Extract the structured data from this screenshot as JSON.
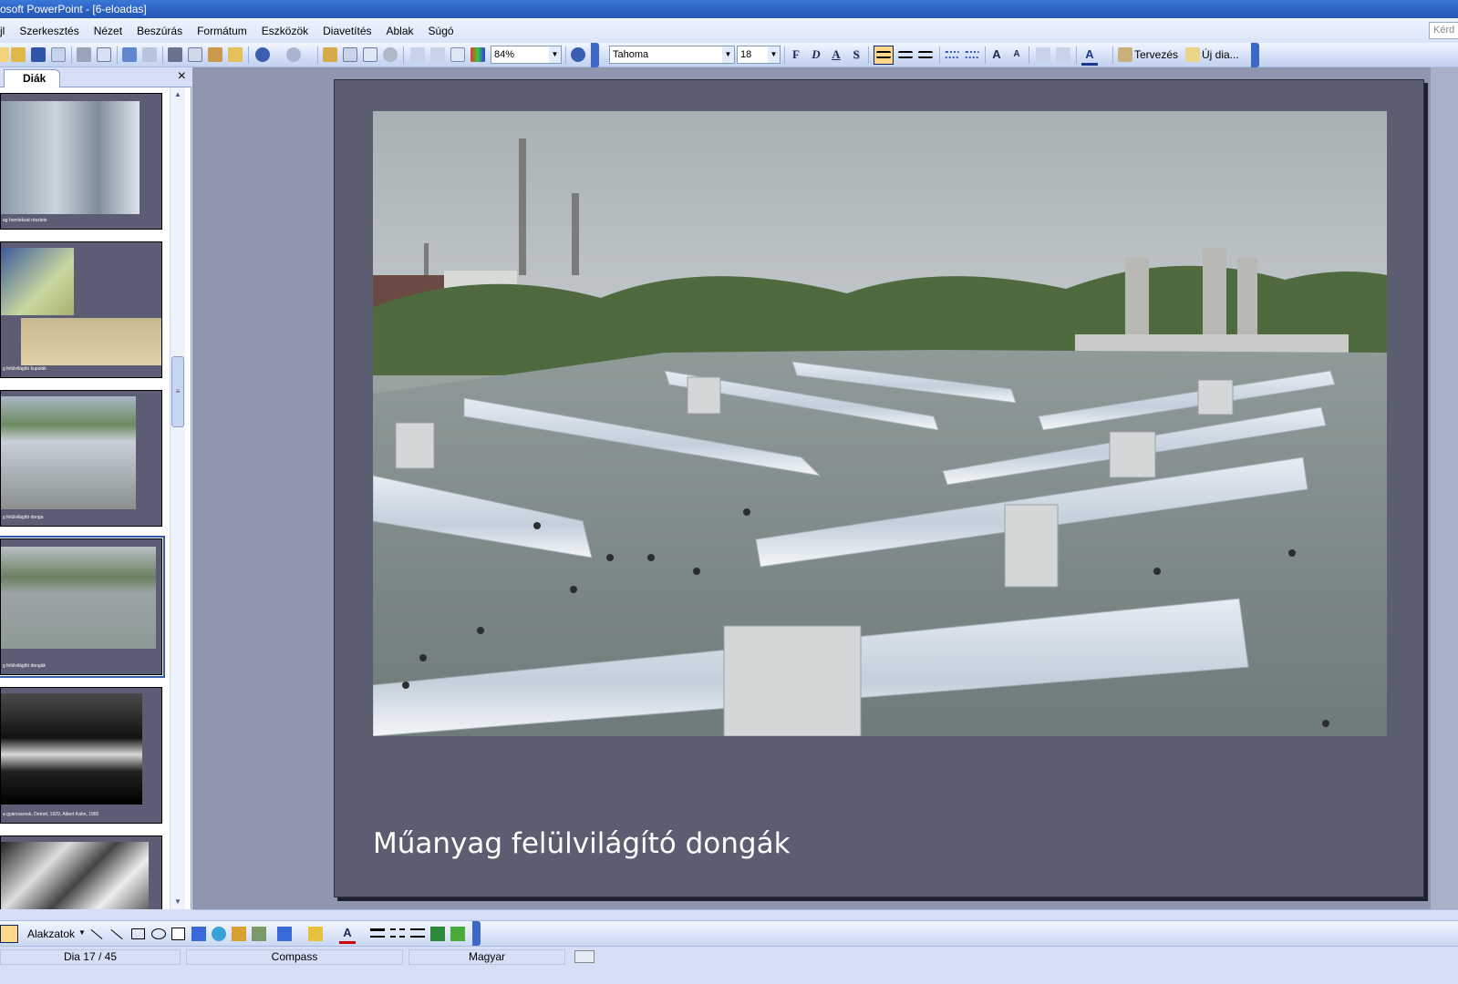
{
  "window": {
    "title": "osoft PowerPoint - [6-eloadas]"
  },
  "menu": {
    "items": [
      "jl",
      "Szerkesztés",
      "Nézet",
      "Beszúrás",
      "Formátum",
      "Eszközök",
      "Diavetítés",
      "Ablak",
      "Súgó"
    ],
    "help_placeholder": "Kérd"
  },
  "toolbar": {
    "zoom": "84%",
    "font_name": "Tahoma",
    "font_size": "18",
    "bold": "F",
    "italic": "D",
    "underline": "A",
    "shadow": "S",
    "design_label": "Tervezés",
    "new_slide_label": "Új dia..."
  },
  "pane": {
    "tab_label": "Diák",
    "close": "×",
    "thumbnails": [
      {
        "caption": "ag homlokzat részlete"
      },
      {
        "caption": "g felülvilágító kupolák"
      },
      {
        "caption": "g felülvilágító donga"
      },
      {
        "caption": "g felülvilágító dongák"
      },
      {
        "caption": "a gyárcsarnok, Detroit, 1929, Albert Kahn, 1955"
      },
      {
        "caption": ""
      }
    ]
  },
  "slide": {
    "title": "Műanyag felülvilágító dongák"
  },
  "drawbar": {
    "shapes_label": "Alakzatok"
  },
  "status": {
    "slide_info": "Dia 17 / 45",
    "design": "Compass",
    "language": "Magyar"
  },
  "colors": {
    "slide_background": "#5b5d70",
    "title_bar": "#2a5fc0",
    "workspace": "#8f96ad"
  }
}
